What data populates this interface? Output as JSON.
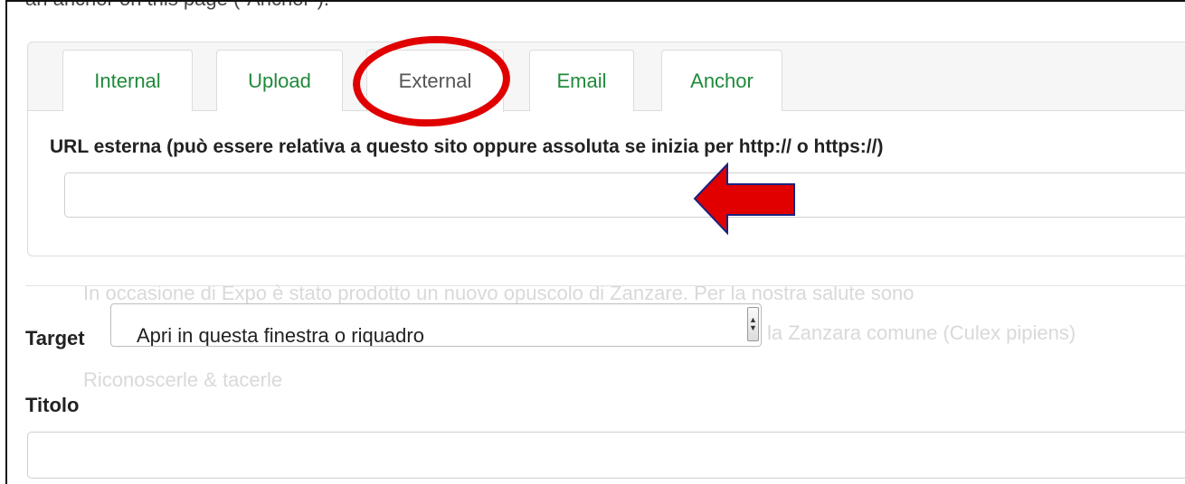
{
  "page": {
    "cut_off_text": "an anchor on this page (\"Anchor\")."
  },
  "tabs": [
    {
      "label": "Internal",
      "active": false
    },
    {
      "label": "Upload",
      "active": false
    },
    {
      "label": "External",
      "active": true
    },
    {
      "label": "Email",
      "active": false
    },
    {
      "label": "Anchor",
      "active": false
    }
  ],
  "external": {
    "url_label": "URL esterna (può essere relativa a questo sito oppure assoluta se inizia per http:// o https://)",
    "url_value": ""
  },
  "background_text": {
    "line1": "In occasione di Expo è stato prodotto un nuovo opuscolo di Zanzare. Per la nostra salute sono",
    "line2": "la Zanzara comune (Culex pipiens)",
    "line3": "Riconoscerle & tacerle"
  },
  "target": {
    "label": "Target",
    "selected": "Apri in questa finestra o riquadro"
  },
  "titolo": {
    "label": "Titolo",
    "value": ""
  },
  "annotation": {
    "circle_color": "#e00000",
    "arrow_color": "#e00000",
    "arrow_outline": "#1a237e"
  }
}
